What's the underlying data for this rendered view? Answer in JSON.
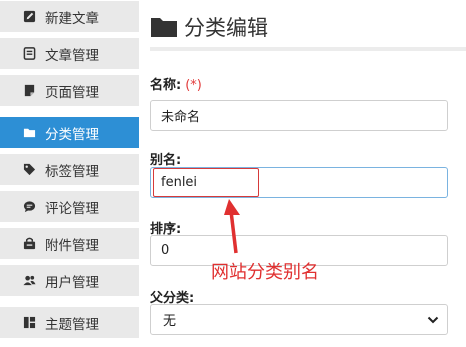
{
  "sidebar": {
    "items": [
      {
        "label": "新建文章",
        "icon": "edit-icon"
      },
      {
        "label": "文章管理",
        "icon": "document-icon"
      },
      {
        "label": "页面管理",
        "icon": "page-icon"
      },
      {
        "label": "分类管理",
        "icon": "folder-icon",
        "active": true
      },
      {
        "label": "标签管理",
        "icon": "tag-icon"
      },
      {
        "label": "评论管理",
        "icon": "comment-icon"
      },
      {
        "label": "附件管理",
        "icon": "attachment-icon"
      },
      {
        "label": "用户管理",
        "icon": "users-icon"
      },
      {
        "label": "主题管理",
        "icon": "theme-icon"
      }
    ]
  },
  "main": {
    "title": "分类编辑",
    "name_label": "名称:",
    "required_mark": "(*)",
    "name_value": "未命名",
    "alias_label": "别名:",
    "alias_value": "fenlei",
    "order_label": "排序:",
    "order_value": "0",
    "parent_label": "父分类:",
    "parent_value": "无",
    "annotation": "网站分类别名"
  },
  "colors": {
    "active": "#2d8fd5",
    "highlight": "#d63a3a",
    "nav_bg": "#e9e9e9"
  }
}
